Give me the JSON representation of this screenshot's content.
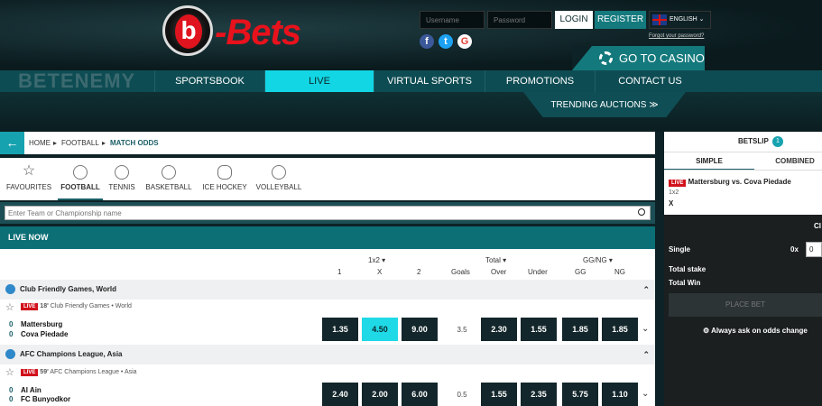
{
  "header": {
    "logo_text": "-Bets",
    "logo_letter": "b",
    "username_placeholder": "Username",
    "password_placeholder": "Password",
    "login_label": "LOGIN",
    "register_label": "REGISTER",
    "language": "ENGLISH",
    "forgot_password": "Forgot your password?",
    "casino_label": "GO TO CASINO",
    "watermark": "BETENEMY"
  },
  "nav": {
    "items": [
      "SPORTSBOOK",
      "LIVE",
      "VIRTUAL SPORTS",
      "PROMOTIONS",
      "CONTACT US"
    ],
    "active": "LIVE",
    "trending": "TRENDING AUCTIONS"
  },
  "breadcrumb": {
    "home": "HOME",
    "football": "FOOTBALL",
    "current": "MATCH ODDS"
  },
  "sports": [
    "FAVOURITES",
    "FOOTBALL",
    "TENNIS",
    "BASKETBALL",
    "ICE HOCKEY",
    "VOLLEYBALL"
  ],
  "search": {
    "placeholder": "Enter Team or Championship name"
  },
  "live_now": "LIVE NOW",
  "markets": {
    "m1": "1x2",
    "m2": "Total",
    "m3": "GG/NG",
    "c1": "1",
    "cx": "X",
    "c2": "2",
    "goals": "Goals",
    "over": "Over",
    "under": "Under",
    "gg": "GG",
    "ng": "NG"
  },
  "leagues": [
    {
      "name": "Club Friendly Games, World",
      "minute": "18'",
      "competition": "Club Friendly Games",
      "region": "World",
      "home": "Mattersburg",
      "away": "Cova Piedade",
      "home_score": "0",
      "away_score": "0",
      "odds": [
        "1.35",
        "4.50",
        "9.00"
      ],
      "goals": "3.5",
      "totals": [
        "2.30",
        "1.55"
      ],
      "ggng": [
        "1.85",
        "1.85"
      ]
    },
    {
      "name": "AFC Champions League, Asia",
      "minute": "59'",
      "competition": "AFC Champions League",
      "region": "Asia",
      "home": "Al Ain",
      "away": "FC Bunyodkor",
      "home_score": "0",
      "away_score": "0",
      "odds": [
        "2.40",
        "2.00",
        "6.00"
      ],
      "goals": "0.5",
      "totals": [
        "1.55",
        "2.35"
      ],
      "ggng": [
        "5.75",
        "1.10"
      ]
    }
  ],
  "live_badge": "LIVE",
  "betslip": {
    "title": "BETSLIP",
    "count": "1",
    "tab_simple": "SIMPLE",
    "tab_combined": "COMBINED",
    "match": "Mattersburg vs. Cova Piedade",
    "market": "1x2",
    "pick": "X",
    "clear": "Cl",
    "single": "Single",
    "single_mult": "0x",
    "stake_value": "0",
    "total_stake": "Total stake",
    "total_win": "Total Win",
    "place_bet": "PLACE BET",
    "always_ask": "Always ask on odds change"
  }
}
